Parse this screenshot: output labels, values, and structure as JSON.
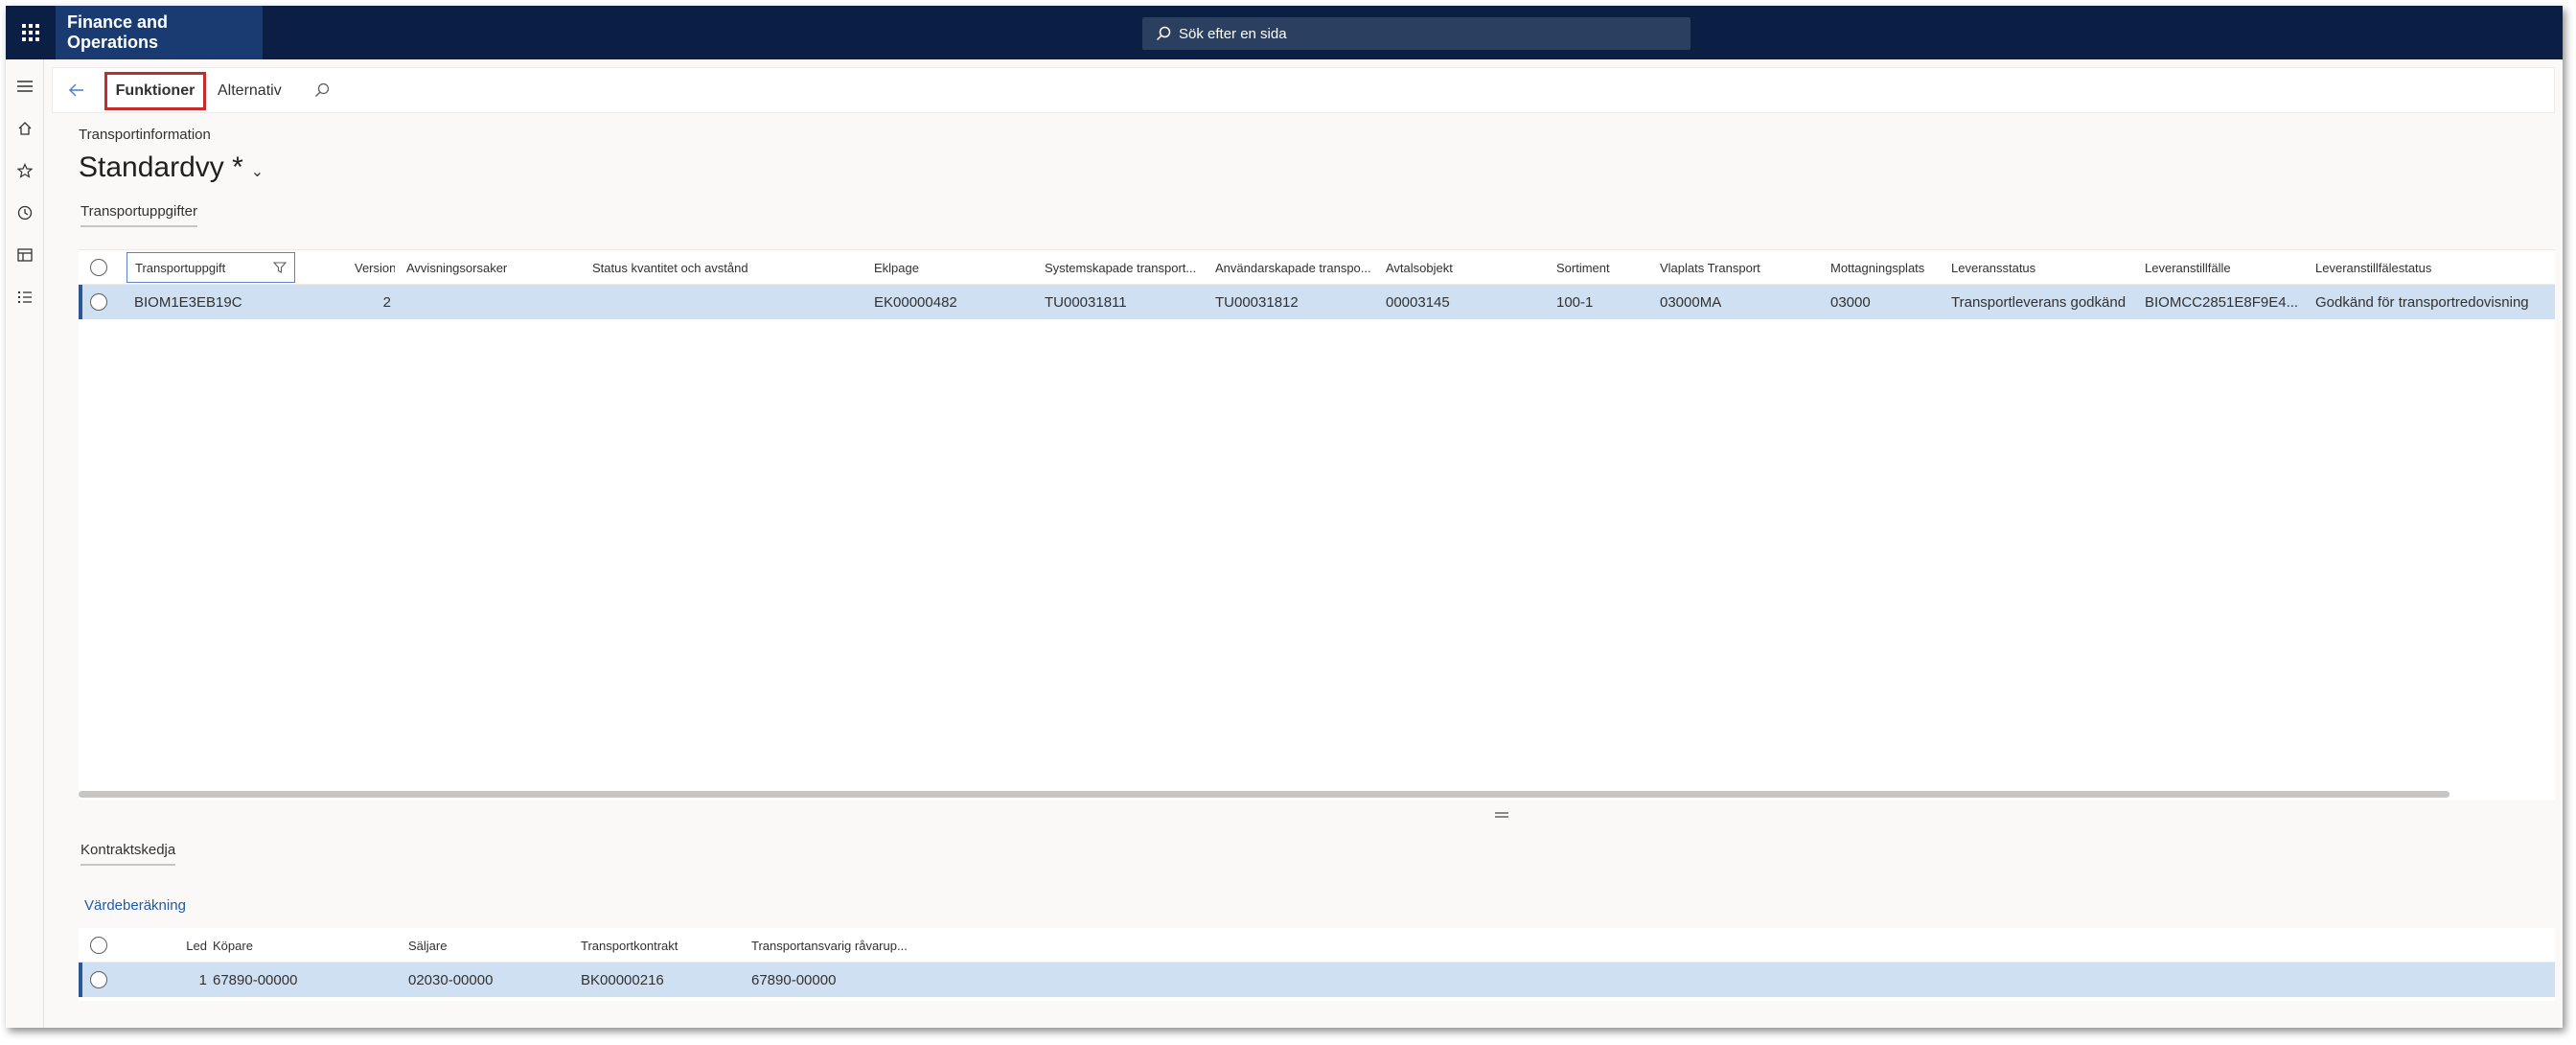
{
  "topbar": {
    "app_title": "Finance and Operations",
    "search_placeholder": "Sök efter en sida"
  },
  "actionbar": {
    "functions_label": "Funktioner",
    "options_label": "Alternativ"
  },
  "page": {
    "breadcrumb": "Transportinformation",
    "title": "Standardvy *",
    "tab_label": "Transportuppgifter"
  },
  "main_grid": {
    "columns": [
      "Transportuppgift",
      "Version",
      "Avvisningsorsaker",
      "Status kvantitet och avstånd",
      "Eklpage",
      "Systemskapade transport...",
      "Användarskapade transpo...",
      "Avtalsobjekt",
      "Sortiment",
      "Vlaplats Transport",
      "Mottagningsplats",
      "Leveransstatus",
      "Leveranstillfälle",
      "Leveranstillfälestatus"
    ],
    "row": {
      "transportuppgift": "BIOM1E3EB19C",
      "version": "2",
      "avvisningsorsaker": "",
      "status": "",
      "eklpage": "EK00000482",
      "systemskapade": "TU00031811",
      "anvandarskapade": "TU00031812",
      "avtalsobjekt": "00003145",
      "sortiment": "100-1",
      "vlaplats": "03000MA",
      "mottagningsplats": "03000",
      "leveransstatus": "Transportleverans godkänd",
      "leveranstillfalle": "BIOMCC2851E8F9E4...",
      "leveranstillfallestatus": "Godkänd för transportredovisning"
    }
  },
  "bottom": {
    "tab_label": "Kontraktskedja",
    "link_label": "Värdeberäkning",
    "columns": [
      "Led",
      "Köpare",
      "Säljare",
      "Transportkontrakt",
      "Transportansvarig råvarup..."
    ],
    "row": {
      "led": "1",
      "kopare": "67890-00000",
      "saljare": "02030-00000",
      "transportkontrakt": "BK00000216",
      "ansvarig": "67890-00000"
    }
  },
  "colors": {
    "topbar": "#0b1f44",
    "app_tile": "#1a3b72",
    "selected_row": "#cfe0f3",
    "link": "#1f5aa6",
    "highlight_border": "#c42b2b"
  }
}
